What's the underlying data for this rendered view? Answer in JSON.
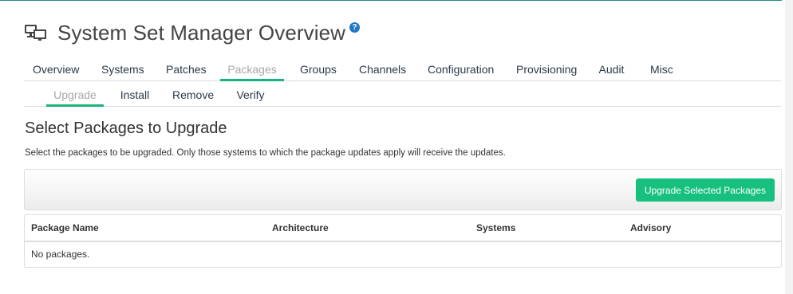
{
  "page": {
    "title": "System Set Manager Overview",
    "help_icon": "?"
  },
  "tabs": [
    {
      "label": "Overview",
      "active": false
    },
    {
      "label": "Systems",
      "active": false
    },
    {
      "label": "Patches",
      "active": false
    },
    {
      "label": "Packages",
      "active": true
    },
    {
      "label": "Groups",
      "active": false
    },
    {
      "label": "Channels",
      "active": false
    },
    {
      "label": "Configuration",
      "active": false
    },
    {
      "label": "Provisioning",
      "active": false
    },
    {
      "label": "Audit",
      "active": false
    },
    {
      "label": "Misc",
      "active": false
    }
  ],
  "subtabs": [
    {
      "label": "Upgrade",
      "active": true
    },
    {
      "label": "Install",
      "active": false
    },
    {
      "label": "Remove",
      "active": false
    },
    {
      "label": "Verify",
      "active": false
    }
  ],
  "section": {
    "title": "Select Packages to Upgrade",
    "description": "Select the packages to be upgraded. Only those systems to which the package updates apply will receive the updates."
  },
  "toolbar": {
    "upgrade_label": "Upgrade Selected Packages"
  },
  "table": {
    "columns": [
      "Package Name",
      "Architecture",
      "Systems",
      "Advisory"
    ],
    "empty_message": "No packages."
  },
  "colors": {
    "accent": "#18b57a",
    "button": "#18c080",
    "help_icon": "#1f77c6",
    "top_line": "#2a8a86"
  },
  "icons": {
    "title_icon": "systems-monitor-icon",
    "help": "help-icon"
  }
}
